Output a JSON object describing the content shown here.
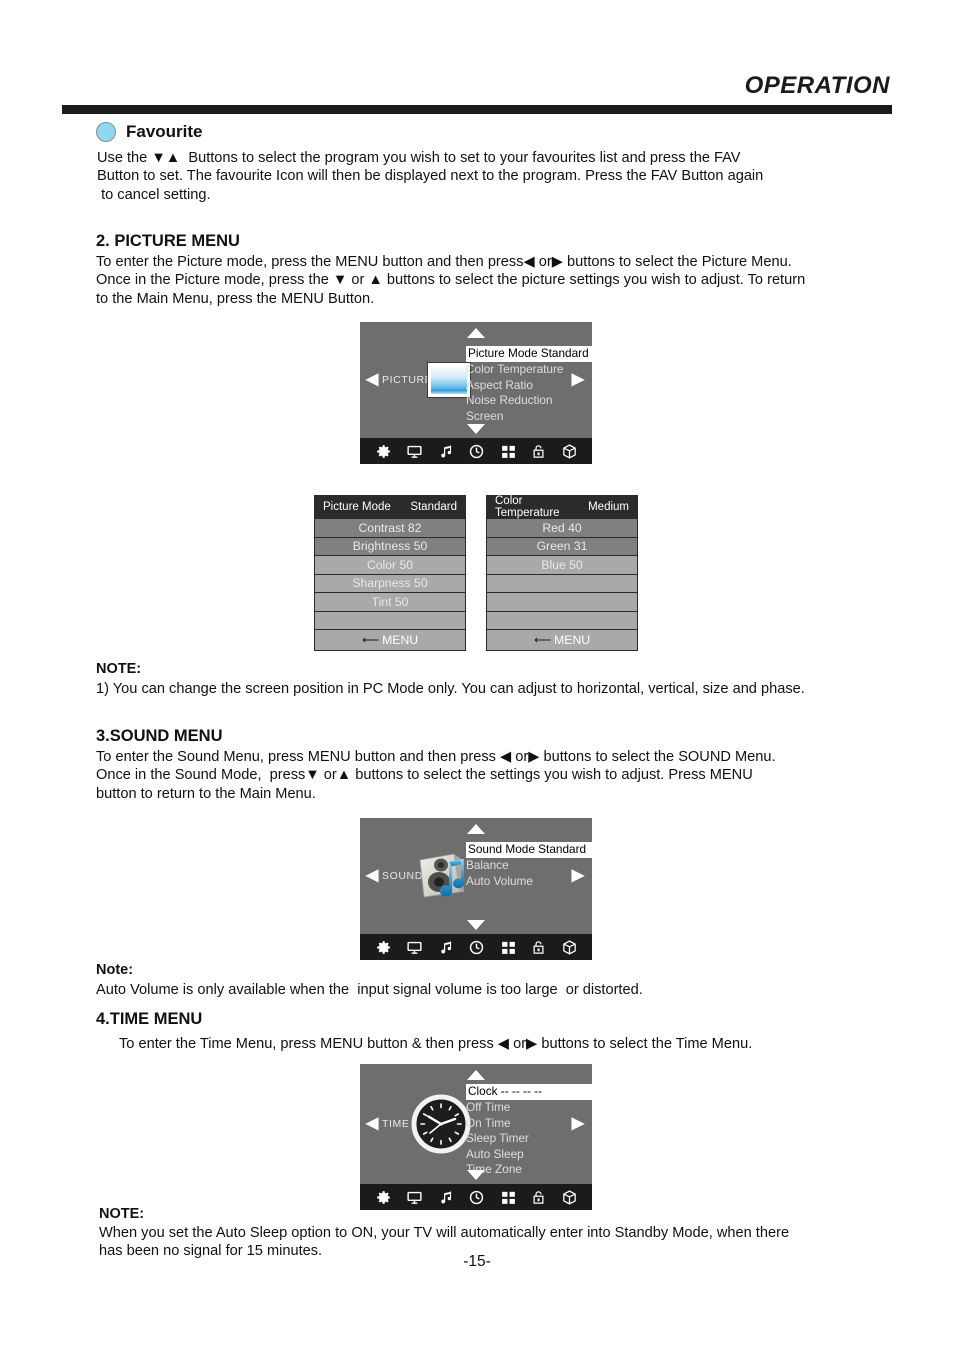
{
  "header": {
    "title": "OPERATION"
  },
  "favourite": {
    "icon": "filled-circle-icon",
    "heading": "Favourite",
    "body": "Use the ▼▲  Buttons to select the program you wish to set to your favourites list and press the FAV\nButton to set. The favourite Icon will then be displayed next to the program. Press the FAV Button again\n to cancel setting."
  },
  "picture_section": {
    "heading": "2. PICTURE MENU",
    "body": "To enter the Picture mode, press the MENU button and then press◀ or▶ buttons to select the Picture Menu.\nOnce in the Picture mode, press the ▼ or ▲ buttons to select the picture settings you wish to adjust. To return\nto the Main Menu, press the MENU Button.",
    "osd": {
      "category": "PICTURE",
      "left_chevron": "◀",
      "right_chevron": "▶",
      "up_arrow": "▲",
      "down_arrow": "▼",
      "thumbnail": "picture-landscape-thumb",
      "items": [
        {
          "label": "Picture Mode Standard",
          "selected": true
        },
        {
          "label": "Color Temperature",
          "selected": false
        },
        {
          "label": "Aspect Ratio",
          "selected": false
        },
        {
          "label": "Noise Reduction",
          "selected": false
        },
        {
          "label": "Screen",
          "selected": false
        }
      ],
      "iconbar": [
        "gear-icon",
        "monitor-icon",
        "music-note-icon",
        "clock-icon",
        "grid-icon",
        "lock-icon",
        "cube-icon"
      ]
    },
    "submenu_picture": {
      "title_left": "Picture Mode",
      "title_right": "Standard",
      "rows": [
        "Contrast 82",
        "Brightness 50",
        "Color 50",
        "Sharpness 50",
        "Tint 50",
        ""
      ],
      "footer": "MENU"
    },
    "submenu_color": {
      "title_left": "Color Temperature",
      "title_right": "Medium",
      "rows": [
        "Red 40",
        "Green 31",
        "Blue 50",
        "",
        "",
        ""
      ],
      "footer": "MENU"
    },
    "note_label": "NOTE:",
    "note_body": "1) You can change the screen position in PC Mode only. You can adjust to horizontal, vertical, size and phase."
  },
  "sound_section": {
    "heading": "3.SOUND MENU",
    "body": "To enter the Sound Menu, press MENU button and then press ◀ or▶ buttons to select the SOUND Menu.\nOnce in the Sound Mode,  press▼ or▲ buttons to select the settings you wish to adjust. Press MENU\nbutton to return to the Main Menu.",
    "osd": {
      "category": "SOUND",
      "left_chevron": "◀",
      "right_chevron": "▶",
      "up_arrow": "▲",
      "down_arrow": "▼",
      "thumbnail": "speaker-music-note-thumb",
      "items": [
        {
          "label": "Sound Mode Standard",
          "selected": true
        },
        {
          "label": "Balance",
          "selected": false
        },
        {
          "label": "Auto Volume",
          "selected": false
        }
      ],
      "iconbar": [
        "gear-icon",
        "monitor-icon",
        "music-note-icon",
        "clock-icon",
        "grid-icon",
        "lock-icon",
        "cube-icon"
      ]
    },
    "note_label": "Note:",
    "note_body": "Auto Volume is only available when the  input signal volume is too large  or distorted."
  },
  "time_section": {
    "heading": "4.TIME MENU",
    "body": "To enter the Time Menu, press MENU button & then press ◀ or▶ buttons to select the Time Menu.",
    "osd": {
      "category": "TIME",
      "left_chevron": "◀",
      "right_chevron": "▶",
      "up_arrow": "▲",
      "down_arrow": "▼",
      "thumbnail": "analog-clock-thumb",
      "items": [
        {
          "label": "Clock --    --    --    --",
          "selected": true
        },
        {
          "label": "Off Time",
          "selected": false
        },
        {
          "label": "On Time",
          "selected": false
        },
        {
          "label": "Sleep Timer",
          "selected": false
        },
        {
          "label": "Auto Sleep",
          "selected": false
        },
        {
          "label": "Time Zone",
          "selected": false
        }
      ],
      "iconbar": [
        "gear-icon",
        "monitor-icon",
        "music-note-icon",
        "clock-icon",
        "grid-icon",
        "lock-icon",
        "cube-icon"
      ]
    },
    "note_label": "NOTE:",
    "note_body": "When you set the Auto Sleep option to ON, your TV will automatically enter into Standby Mode, when there\nhas been no signal for 15 minutes."
  },
  "page_number": "-15-",
  "colors": {
    "osd_background": "#6e6e6e",
    "osd_iconbar": "#1b1b1b",
    "favourite_circle": "#8ed8f2",
    "rule": "#1b1b1b",
    "submenu_row_dark": "#808080",
    "submenu_row_light": "#a9a9a9",
    "submenu_title": "#2b2b2b"
  }
}
